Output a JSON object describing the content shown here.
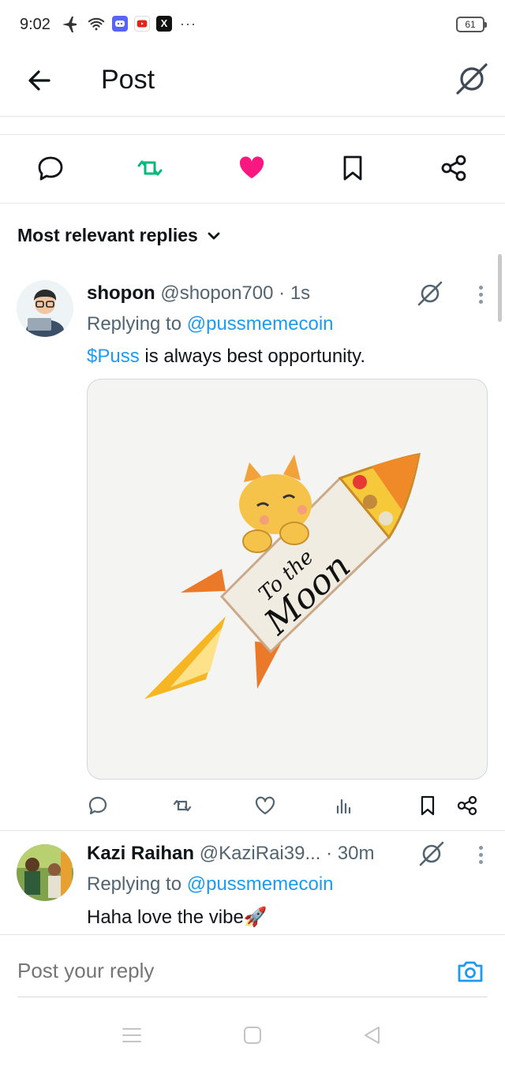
{
  "status_bar": {
    "time": "9:02",
    "battery": "61",
    "more": "···",
    "x_badge": "X"
  },
  "header": {
    "title": "Post"
  },
  "sort": {
    "label": "Most relevant replies"
  },
  "replies": [
    {
      "name": "shopon",
      "handle": "@shopon700",
      "time": "· 1s",
      "replying_prefix": "Replying to",
      "replying_to": "@pussmemecoin",
      "cashtag": "$Puss",
      "text": " is always best opportunity.",
      "media": {
        "line1": "To the",
        "line2": "Moon"
      }
    },
    {
      "name": "Kazi Raihan",
      "handle": "@KaziRai39...",
      "time": "· 30m",
      "replying_prefix": "Replying to",
      "replying_to": "@pussmemecoin",
      "text": "Haha love the vibe🚀"
    }
  ],
  "composer": {
    "placeholder": "Post your reply"
  },
  "colors": {
    "accent": "#1d9bf0",
    "like": "#f91880",
    "retweet": "#00ba7c",
    "secondary_text": "#536471"
  }
}
